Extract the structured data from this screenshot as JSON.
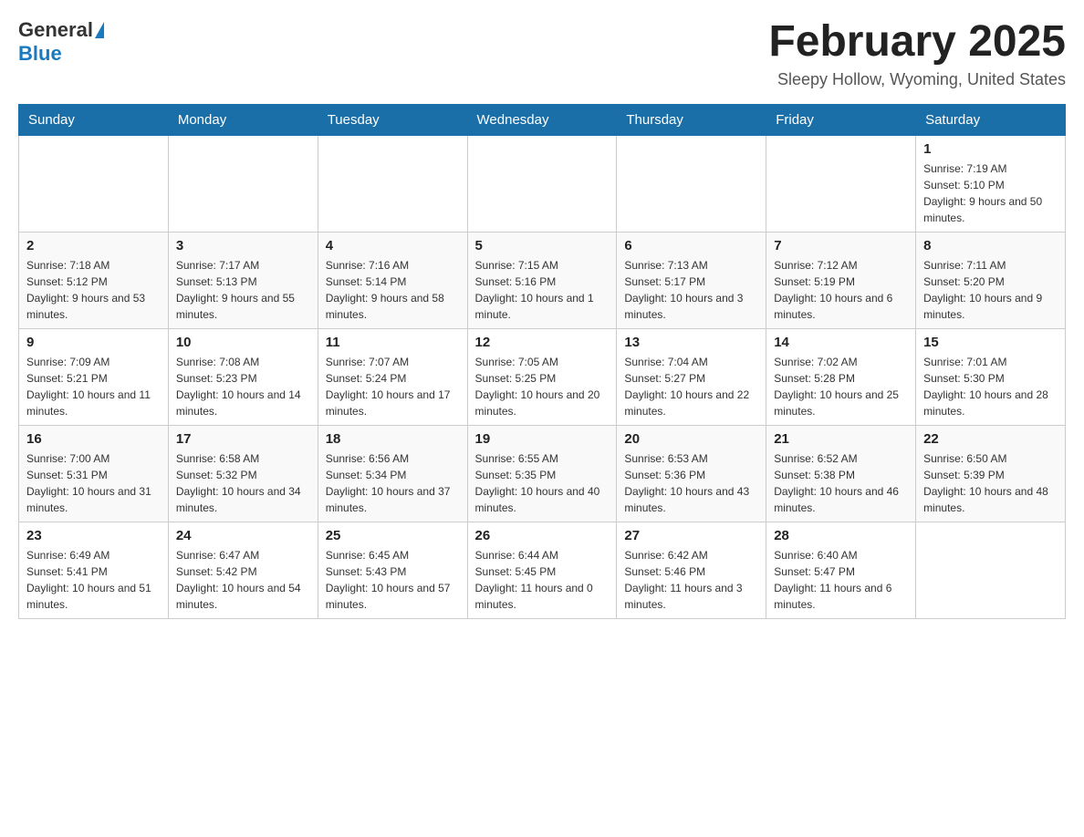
{
  "header": {
    "logo_general": "General",
    "logo_blue": "Blue",
    "month_title": "February 2025",
    "subtitle": "Sleepy Hollow, Wyoming, United States"
  },
  "days_of_week": [
    "Sunday",
    "Monday",
    "Tuesday",
    "Wednesday",
    "Thursday",
    "Friday",
    "Saturday"
  ],
  "weeks": [
    {
      "days": [
        {
          "date": "",
          "info": ""
        },
        {
          "date": "",
          "info": ""
        },
        {
          "date": "",
          "info": ""
        },
        {
          "date": "",
          "info": ""
        },
        {
          "date": "",
          "info": ""
        },
        {
          "date": "",
          "info": ""
        },
        {
          "date": "1",
          "info": "Sunrise: 7:19 AM\nSunset: 5:10 PM\nDaylight: 9 hours and 50 minutes."
        }
      ]
    },
    {
      "days": [
        {
          "date": "2",
          "info": "Sunrise: 7:18 AM\nSunset: 5:12 PM\nDaylight: 9 hours and 53 minutes."
        },
        {
          "date": "3",
          "info": "Sunrise: 7:17 AM\nSunset: 5:13 PM\nDaylight: 9 hours and 55 minutes."
        },
        {
          "date": "4",
          "info": "Sunrise: 7:16 AM\nSunset: 5:14 PM\nDaylight: 9 hours and 58 minutes."
        },
        {
          "date": "5",
          "info": "Sunrise: 7:15 AM\nSunset: 5:16 PM\nDaylight: 10 hours and 1 minute."
        },
        {
          "date": "6",
          "info": "Sunrise: 7:13 AM\nSunset: 5:17 PM\nDaylight: 10 hours and 3 minutes."
        },
        {
          "date": "7",
          "info": "Sunrise: 7:12 AM\nSunset: 5:19 PM\nDaylight: 10 hours and 6 minutes."
        },
        {
          "date": "8",
          "info": "Sunrise: 7:11 AM\nSunset: 5:20 PM\nDaylight: 10 hours and 9 minutes."
        }
      ]
    },
    {
      "days": [
        {
          "date": "9",
          "info": "Sunrise: 7:09 AM\nSunset: 5:21 PM\nDaylight: 10 hours and 11 minutes."
        },
        {
          "date": "10",
          "info": "Sunrise: 7:08 AM\nSunset: 5:23 PM\nDaylight: 10 hours and 14 minutes."
        },
        {
          "date": "11",
          "info": "Sunrise: 7:07 AM\nSunset: 5:24 PM\nDaylight: 10 hours and 17 minutes."
        },
        {
          "date": "12",
          "info": "Sunrise: 7:05 AM\nSunset: 5:25 PM\nDaylight: 10 hours and 20 minutes."
        },
        {
          "date": "13",
          "info": "Sunrise: 7:04 AM\nSunset: 5:27 PM\nDaylight: 10 hours and 22 minutes."
        },
        {
          "date": "14",
          "info": "Sunrise: 7:02 AM\nSunset: 5:28 PM\nDaylight: 10 hours and 25 minutes."
        },
        {
          "date": "15",
          "info": "Sunrise: 7:01 AM\nSunset: 5:30 PM\nDaylight: 10 hours and 28 minutes."
        }
      ]
    },
    {
      "days": [
        {
          "date": "16",
          "info": "Sunrise: 7:00 AM\nSunset: 5:31 PM\nDaylight: 10 hours and 31 minutes."
        },
        {
          "date": "17",
          "info": "Sunrise: 6:58 AM\nSunset: 5:32 PM\nDaylight: 10 hours and 34 minutes."
        },
        {
          "date": "18",
          "info": "Sunrise: 6:56 AM\nSunset: 5:34 PM\nDaylight: 10 hours and 37 minutes."
        },
        {
          "date": "19",
          "info": "Sunrise: 6:55 AM\nSunset: 5:35 PM\nDaylight: 10 hours and 40 minutes."
        },
        {
          "date": "20",
          "info": "Sunrise: 6:53 AM\nSunset: 5:36 PM\nDaylight: 10 hours and 43 minutes."
        },
        {
          "date": "21",
          "info": "Sunrise: 6:52 AM\nSunset: 5:38 PM\nDaylight: 10 hours and 46 minutes."
        },
        {
          "date": "22",
          "info": "Sunrise: 6:50 AM\nSunset: 5:39 PM\nDaylight: 10 hours and 48 minutes."
        }
      ]
    },
    {
      "days": [
        {
          "date": "23",
          "info": "Sunrise: 6:49 AM\nSunset: 5:41 PM\nDaylight: 10 hours and 51 minutes."
        },
        {
          "date": "24",
          "info": "Sunrise: 6:47 AM\nSunset: 5:42 PM\nDaylight: 10 hours and 54 minutes."
        },
        {
          "date": "25",
          "info": "Sunrise: 6:45 AM\nSunset: 5:43 PM\nDaylight: 10 hours and 57 minutes."
        },
        {
          "date": "26",
          "info": "Sunrise: 6:44 AM\nSunset: 5:45 PM\nDaylight: 11 hours and 0 minutes."
        },
        {
          "date": "27",
          "info": "Sunrise: 6:42 AM\nSunset: 5:46 PM\nDaylight: 11 hours and 3 minutes."
        },
        {
          "date": "28",
          "info": "Sunrise: 6:40 AM\nSunset: 5:47 PM\nDaylight: 11 hours and 6 minutes."
        },
        {
          "date": "",
          "info": ""
        }
      ]
    }
  ]
}
